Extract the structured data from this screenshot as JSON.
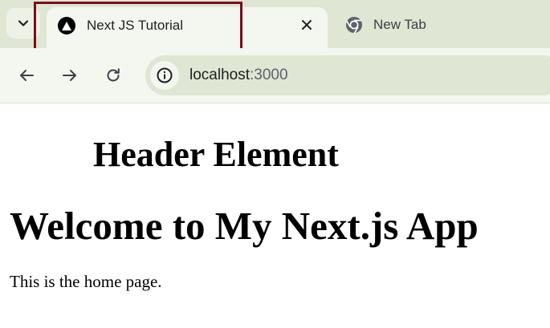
{
  "browser": {
    "tabs": [
      {
        "title": "Next JS Tutorial",
        "active": true,
        "favicon": "nextjs-icon"
      },
      {
        "title": "New Tab",
        "active": false,
        "favicon": "chrome-icon"
      }
    ],
    "address_bar": {
      "host": "localhost",
      "port": ":3000"
    }
  },
  "page": {
    "header_element": "Header Element",
    "heading": "Welcome to My Next.js App",
    "paragraph": "This is the home page."
  },
  "colors": {
    "tabstrip_bg": "#dfe6d3",
    "toolbar_bg": "#f4f7ef",
    "highlight_border": "#7a0f1b"
  }
}
